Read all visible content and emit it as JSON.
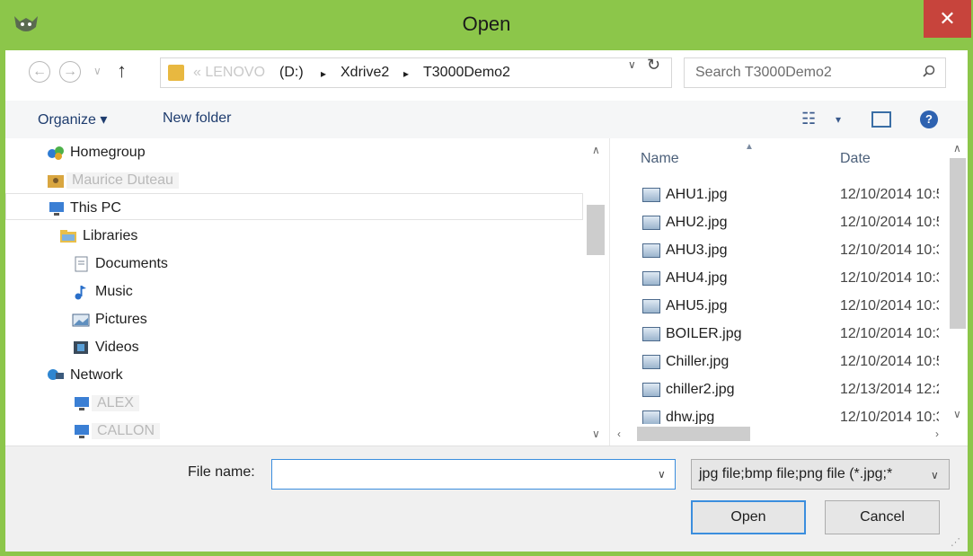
{
  "window": {
    "title": "Open",
    "close_glyph": "✕",
    "colors": {
      "frame": "#8cc64a",
      "close": "#c7443c",
      "accent": "#3b8ede"
    }
  },
  "address_bar": {
    "back_glyph": "←",
    "forward_glyph": "→",
    "up_glyph": "↑",
    "crumbs": [
      "« LENOVO",
      "(D:)",
      "▸",
      "Xdrive2",
      "▸",
      "T3000Demo2"
    ],
    "dropdown_glyph": "∨",
    "refresh_glyph": "↻"
  },
  "search": {
    "placeholder": "Search T3000Demo2",
    "icon": "search-icon"
  },
  "toolbar": {
    "organize_label": "Organize ▾",
    "new_folder_label": "New folder",
    "view_glyph": "☷",
    "view_dd_glyph": "▾",
    "help_glyph": "?"
  },
  "nav": {
    "items": [
      {
        "label": "Homegroup",
        "icon": "homegroup-icon"
      },
      {
        "label": "Maurice Duteau",
        "icon": "user-folder-icon"
      },
      {
        "label": "This PC",
        "icon": "computer-icon"
      },
      {
        "label": "Libraries",
        "icon": "libraries-icon"
      },
      {
        "label": "Documents",
        "icon": "documents-icon"
      },
      {
        "label": "Music",
        "icon": "music-icon"
      },
      {
        "label": "Pictures",
        "icon": "pictures-icon"
      },
      {
        "label": "Videos",
        "icon": "videos-icon"
      },
      {
        "label": "Network",
        "icon": "network-icon"
      },
      {
        "label": "ALEX",
        "icon": "computer-icon"
      },
      {
        "label": "CALLON",
        "icon": "computer-icon"
      }
    ]
  },
  "file_list": {
    "columns": [
      "Name",
      "Date"
    ],
    "rows": [
      {
        "name": "AHU1.jpg",
        "date": "12/10/2014 10:5"
      },
      {
        "name": "AHU2.jpg",
        "date": "12/10/2014 10:5"
      },
      {
        "name": "AHU3.jpg",
        "date": "12/10/2014 10:3"
      },
      {
        "name": "AHU4.jpg",
        "date": "12/10/2014 10:3"
      },
      {
        "name": "AHU5.jpg",
        "date": "12/10/2014 10:3"
      },
      {
        "name": "BOILER.jpg",
        "date": "12/10/2014 10:3"
      },
      {
        "name": "Chiller.jpg",
        "date": "12/10/2014 10:5"
      },
      {
        "name": "chiller2.jpg",
        "date": "12/13/2014 12:2"
      },
      {
        "name": "dhw.jpg",
        "date": "12/10/2014 10:3"
      }
    ]
  },
  "bottom": {
    "file_name_label": "File name:",
    "file_name_value": "",
    "file_type": "jpg file;bmp file;png file (*.jpg;*",
    "open_label": "Open",
    "cancel_label": "Cancel"
  }
}
